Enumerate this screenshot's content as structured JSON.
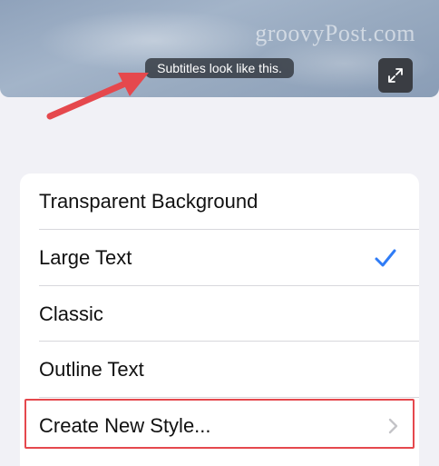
{
  "preview": {
    "watermark": "groovyPost.com",
    "subtitle_sample": "Subtitles look like this.",
    "expand_icon": "expand-arrows-icon"
  },
  "annotation": {
    "arrow_color": "#e5484d",
    "highlight_color": "#e5484d"
  },
  "styles_list": {
    "items": [
      {
        "label": "Transparent Background",
        "selected": false
      },
      {
        "label": "Large Text",
        "selected": true,
        "icon": "checkmark-icon"
      },
      {
        "label": "Classic",
        "selected": false
      },
      {
        "label": "Outline Text",
        "selected": false
      },
      {
        "label": "Create New Style...",
        "icon": "chevron-right-icon"
      }
    ],
    "accent_color": "#2f7cf6"
  }
}
